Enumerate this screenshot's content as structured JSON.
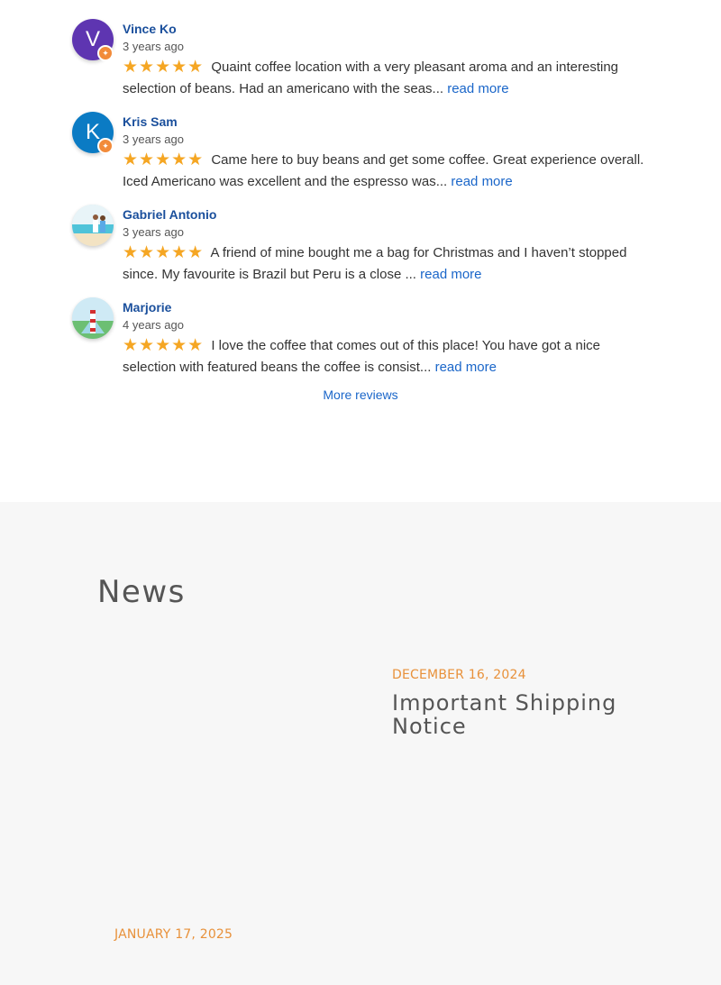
{
  "reviews": [
    {
      "initial": "V",
      "avatar_color": "#5e35b1",
      "name": "Vince Ko",
      "date": "3 years ago",
      "text": "Quaint coffee location with a very pleasant aroma and an interesting selection of beans. Had an americano with the seas...",
      "read_more": "read more",
      "rating": 5
    },
    {
      "initial": "K",
      "avatar_color": "#0b7bc4",
      "name": "Kris Sam",
      "date": "3 years ago",
      "text": "Came here to buy beans and get some coffee. Great experience overall. Iced Americano was excellent and the espresso was...",
      "read_more": "read more",
      "rating": 5
    },
    {
      "initial": "",
      "avatar_color": "#cfe8ee",
      "name": "Gabriel Antonio",
      "date": "3 years ago",
      "text": "A friend of mine bought me a bag for Christmas and I haven’t stopped since. My favourite is Brazil but Peru is a close ...",
      "read_more": "read more",
      "rating": 5
    },
    {
      "initial": "",
      "avatar_color": "#d8eef3",
      "name": "Marjorie",
      "date": "4 years ago",
      "text": "I love the coffee that comes out of this place! You have got a nice selection with featured beans the coffee is consist...",
      "read_more": "read more",
      "rating": 5
    }
  ],
  "stars": "★★★★★",
  "more_reviews": "More reviews",
  "news": {
    "title": "News",
    "posts": [
      {
        "date": "DECEMBER 16, 2024",
        "headline": "Important Shipping Notice"
      },
      {
        "date": "JANUARY 17, 2025",
        "headline": ""
      }
    ]
  },
  "colors": {
    "star": "#f5a623",
    "link": "#1a66c9",
    "name": "#1a4f9c",
    "news_date": "#e8913a",
    "badge": "#f28b3a"
  }
}
